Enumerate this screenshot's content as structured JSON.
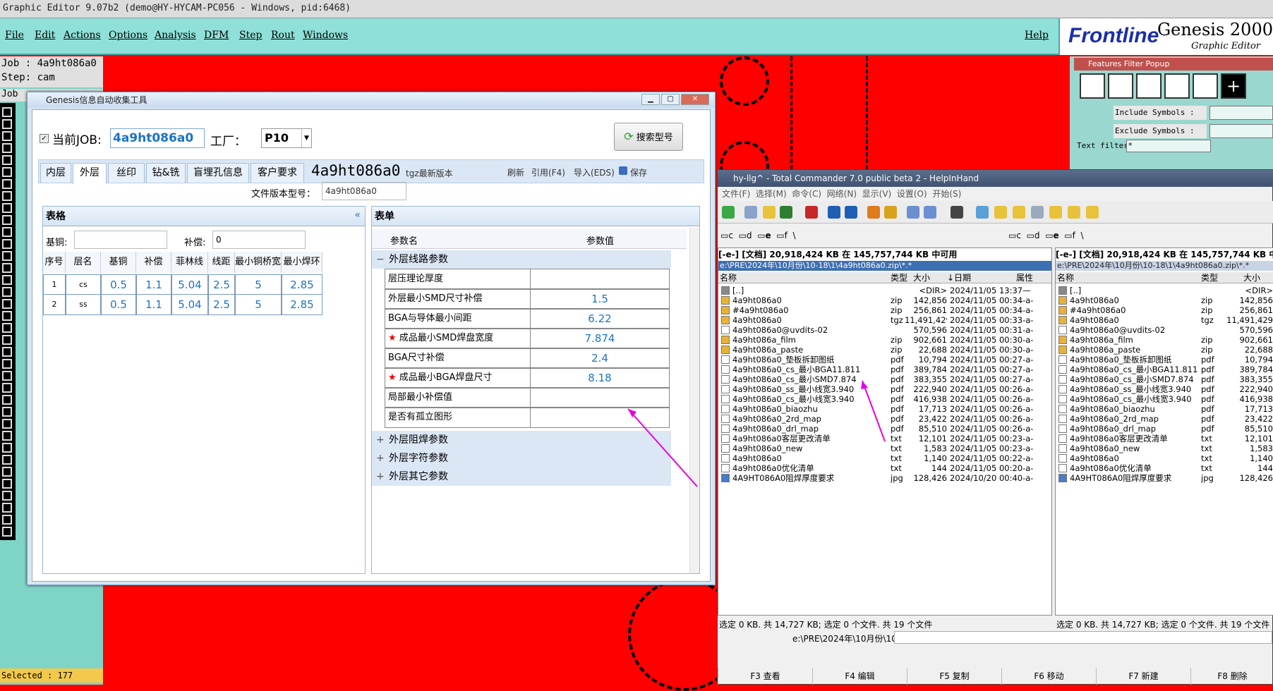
{
  "genesis": {
    "title": "Graphic Editor 9.07b2 (demo@HY-HYCAM-PC056 - Windows, pid:6468)",
    "menus": [
      "File",
      "Edit",
      "Actions",
      "Options",
      "Analysis",
      "DFM",
      "Step",
      "Rout",
      "Windows"
    ],
    "help": "Help",
    "logo": {
      "brand": "Frontline",
      "product": "Genesis 2000",
      "sub": "Graphic Editor"
    },
    "job_line": "Job : 4a9ht086a0",
    "step_line": "Step: cam",
    "job_label": "Job",
    "selected": "Selected : 177",
    "features_filter": {
      "title": "Features Filter Popup",
      "include": "Include Symbols :",
      "exclude": "Exclude Symbols :",
      "text_filter": "Text filter",
      "text_value": "*"
    }
  },
  "dialog": {
    "title": "Genesis信息自动收集工具",
    "current_job_label": "当前JOB:",
    "current_job_value": "4a9ht086a0",
    "factory_label": "工厂：",
    "factory_value": "P10",
    "search_button": "搜索型号",
    "tabs": [
      "内层",
      "外层",
      "丝印",
      "钻&铣",
      "盲埋孔信息",
      "客户要求"
    ],
    "big_job": "4a9ht086a0",
    "tgz_note": "tgz最新版本",
    "actions": [
      "刷新",
      "引用(F4)",
      "导入(EDS)",
      "保存"
    ],
    "version_label": "文件版本型号：",
    "version_value": "4a9ht086a0",
    "table": {
      "title": "表格",
      "base_cu_label": "基铜:",
      "comp_label": "补偿:",
      "comp_value": "0",
      "headers": [
        "序号",
        "层名",
        "基铜",
        "补偿",
        "菲林线宽",
        "线距",
        "最小铜桥宽",
        "最小焊环"
      ],
      "rows": [
        [
          "1",
          "cs",
          "0.5",
          "1.1",
          "5.04",
          "2.5",
          "5",
          "2.85"
        ],
        [
          "2",
          "ss",
          "0.5",
          "1.1",
          "5.04",
          "2.5",
          "5",
          "2.85"
        ]
      ]
    },
    "form": {
      "title": "表单",
      "col_name": "参数名",
      "col_value": "参数值",
      "group_open": "外层线路参数",
      "params": [
        {
          "name": "层压理论厚度",
          "value": "",
          "star": false
        },
        {
          "name": "外层最小SMD尺寸补偿",
          "value": "1.5",
          "star": false
        },
        {
          "name": "BGA与导体最小间距",
          "value": "6.22",
          "star": false
        },
        {
          "name": "成品最小SMD焊盘宽度",
          "value": "7.874",
          "star": true
        },
        {
          "name": "BGA尺寸补偿",
          "value": "2.4",
          "star": false
        },
        {
          "name": "成品最小BGA焊盘尺寸",
          "value": "8.18",
          "star": true
        },
        {
          "name": "局部最小补偿值",
          "value": "",
          "star": false
        },
        {
          "name": "是否有孤立图形",
          "value": "",
          "star": false
        }
      ],
      "groups_closed": [
        "外层阻焊参数",
        "外层字符参数",
        "外层其它参数"
      ]
    }
  },
  "tc": {
    "title": "hy-llg^ - Total Commander 7.0 public beta 2 - HelpInHand",
    "menu": [
      "文件(F)",
      "选择(M)",
      "命令(C)",
      "网络(N)",
      "显示(V)",
      "设置(O)",
      "开始(S)"
    ],
    "drives": [
      "c",
      "d",
      "e",
      "f",
      "\\"
    ],
    "left": {
      "drive_sel": "[-e-]",
      "free": "[文档]  20,918,424 KB 在 145,757,744 KB 中可用",
      "path": "e:\\PRE\\2024年\\10月份\\10-18\\1\\4a9ht086a0.zip\\*.*",
      "cols": [
        "名称",
        "类型",
        "大小",
        "↓日期",
        "属性"
      ],
      "status": "选定 0 KB. 共 14,727 KB; 选定 0 个文件. 共 19 个文件"
    },
    "right": {
      "drive_sel": "[-e-]",
      "free": "[文档]  20,918,424 KB 在 145,757,744 KB 中可",
      "path": "e:\\PRE\\2024年\\10月份\\10-18\\1\\4a9ht086a0.zip\\*.*",
      "cols": [
        "名称",
        "类型",
        "大小"
      ],
      "status": "选定 0 KB. 共 14,727 KB; 选定 0 个文件. 共 19 个文件"
    },
    "files": [
      {
        "name": "[..]",
        "type": "",
        "size": "<DIR>",
        "date": "2024/11/05 13:37—",
        "icon": "up"
      },
      {
        "name": "4a9ht086a0",
        "type": "zip",
        "size": "142,856",
        "date": "2024/11/05 00:34-a-",
        "icon": "zip"
      },
      {
        "name": "#4a9ht086a0",
        "type": "zip",
        "size": "256,861",
        "date": "2024/11/05 00:34-a-",
        "icon": "zip"
      },
      {
        "name": "4a9ht086a0",
        "type": "tgz",
        "size": "11,491,429",
        "date": "2024/11/05 00:33-a-",
        "icon": "zip"
      },
      {
        "name": "4a9ht086a0@uvdits-02",
        "type": "",
        "size": "570,596",
        "date": "2024/11/05 00:31-a-",
        "icon": "file"
      },
      {
        "name": "4a9ht086a_film",
        "type": "zip",
        "size": "902,661",
        "date": "2024/11/05 00:30-a-",
        "icon": "zip"
      },
      {
        "name": "4a9ht086a_paste",
        "type": "zip",
        "size": "22,688",
        "date": "2024/11/05 00:30-a-",
        "icon": "zip"
      },
      {
        "name": "4a9ht086a0_垫板拆卸图纸",
        "type": "pdf",
        "size": "10,794",
        "date": "2024/11/05 00:27-a-",
        "icon": "file"
      },
      {
        "name": "4a9ht086a0_cs_最小BGA11.811",
        "type": "pdf",
        "size": "389,784",
        "date": "2024/11/05 00:27-a-",
        "icon": "file"
      },
      {
        "name": "4a9ht086a0_cs_最小SMD7.874",
        "type": "pdf",
        "size": "383,355",
        "date": "2024/11/05 00:27-a-",
        "icon": "file"
      },
      {
        "name": "4a9ht086a0_ss_最小线宽3.940",
        "type": "pdf",
        "size": "222,940",
        "date": "2024/11/05 00:26-a-",
        "icon": "file"
      },
      {
        "name": "4a9ht086a0_cs_最小线宽3.940",
        "type": "pdf",
        "size": "416,938",
        "date": "2024/11/05 00:26-a-",
        "icon": "file"
      },
      {
        "name": "4a9ht086a0_biaozhu",
        "type": "pdf",
        "size": "17,713",
        "date": "2024/11/05 00:26-a-",
        "icon": "file"
      },
      {
        "name": "4a9ht086a0_2rd_map",
        "type": "pdf",
        "size": "23,422",
        "date": "2024/11/05 00:26-a-",
        "icon": "file"
      },
      {
        "name": "4a9ht086a0_drl_map",
        "type": "pdf",
        "size": "85,510",
        "date": "2024/11/05 00:26-a-",
        "icon": "file"
      },
      {
        "name": "4a9ht086a0客层更改清单",
        "type": "txt",
        "size": "12,101",
        "date": "2024/11/05 00:23-a-",
        "icon": "file"
      },
      {
        "name": "4a9ht086a0_new",
        "type": "txt",
        "size": "1,583",
        "date": "2024/11/05 00:23-a-",
        "icon": "file"
      },
      {
        "name": "4a9ht086a0",
        "type": "txt",
        "size": "1,140",
        "date": "2024/11/05 00:22-a-",
        "icon": "file"
      },
      {
        "name": "4a9ht086a0优化清单",
        "type": "txt",
        "size": "144",
        "date": "2024/11/05 00:20-a-",
        "icon": "file"
      },
      {
        "name": "4A9HT086A0阻焊厚度要求",
        "type": "jpg",
        "size": "128,426",
        "date": "2024/10/20 00:40-a-",
        "icon": "img"
      }
    ],
    "cmdline": "e:\\PRE\\2024年\\10月份\\10-18\\1>",
    "fkeys": [
      "F3 查看",
      "F4 编辑",
      "F5 复制",
      "F6 移动",
      "F7 新建",
      "F8 删除"
    ]
  },
  "colors": {
    "board_red": "#ff0000",
    "accent_blue": "#1a73c8",
    "arrow": "#e600e6"
  }
}
